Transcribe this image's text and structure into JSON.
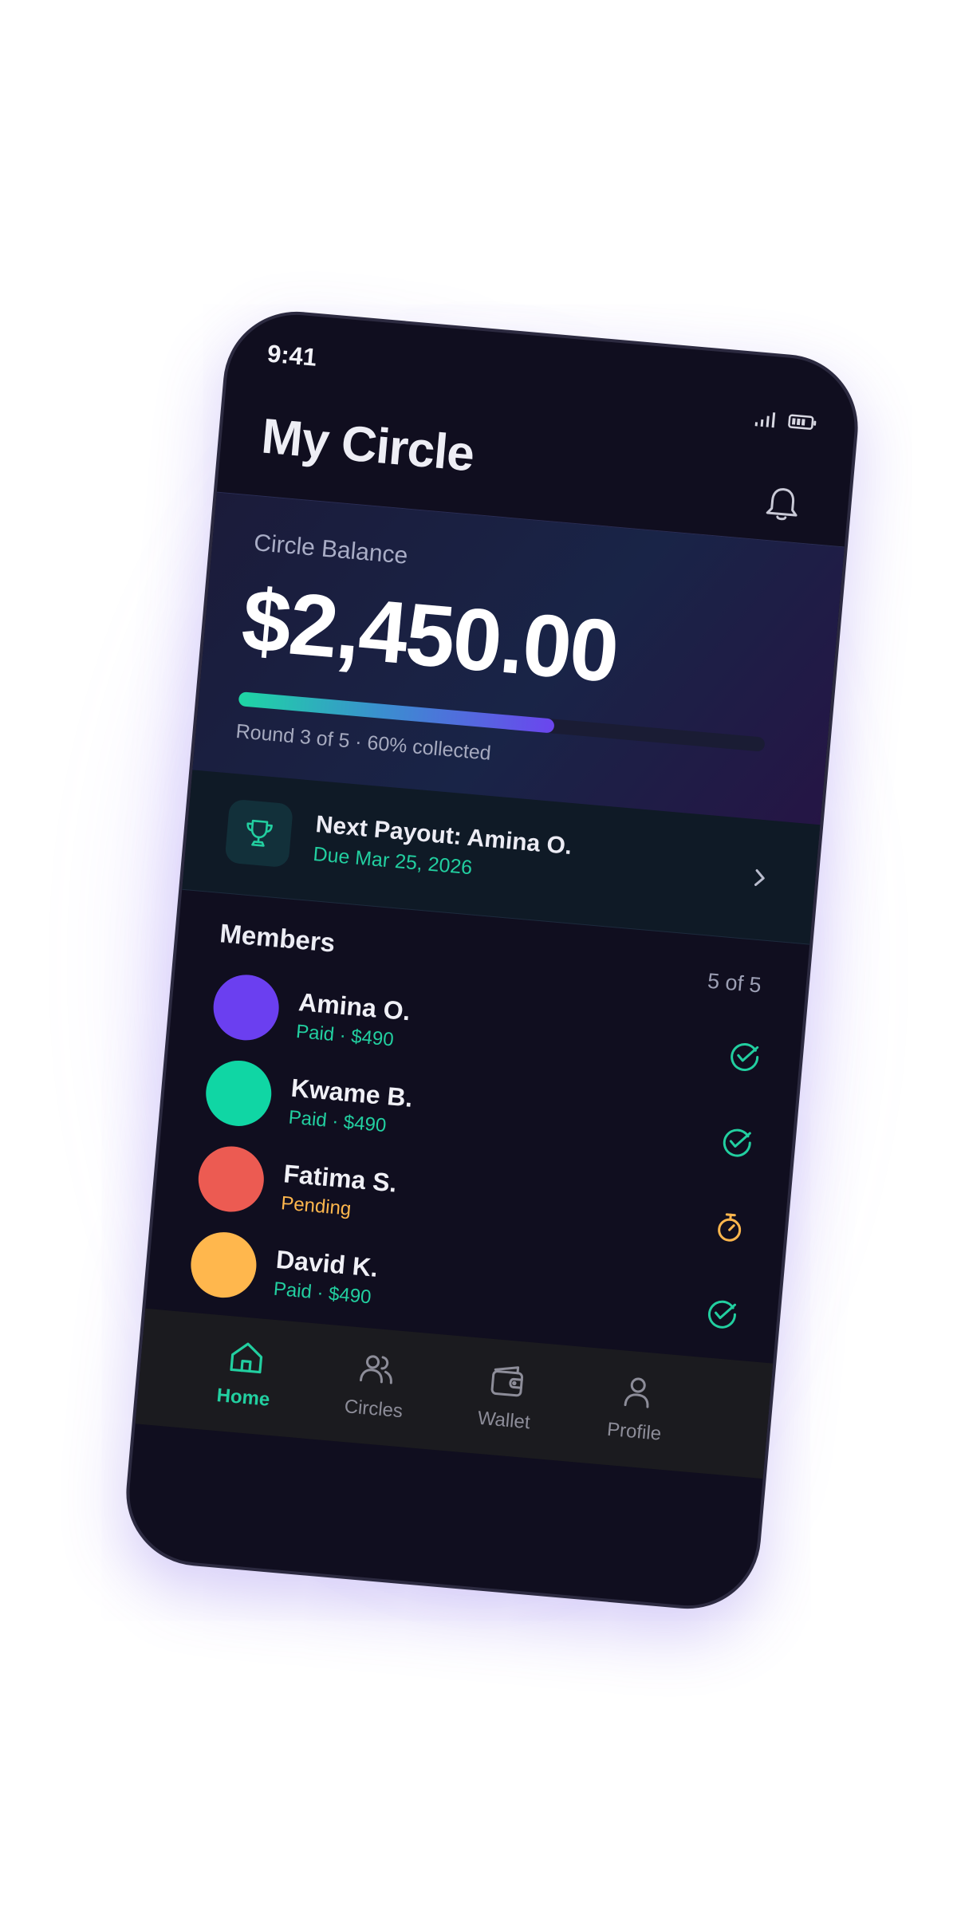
{
  "status_bar": {
    "time": "9:41"
  },
  "header": {
    "title": "My Circle"
  },
  "balance": {
    "label": "Circle Balance",
    "amount": "$2,450.00",
    "progress": 0.6,
    "round_text": "Round 3 of 5 · 60% collected"
  },
  "payout": {
    "title": "Next Payout: Amina O.",
    "due": "Due Mar 25, 2026"
  },
  "members": {
    "title": "Members",
    "count": "5 of 5",
    "items": [
      {
        "name": "Amina O.",
        "status": "Paid · $490",
        "avatar_color": "#6b3ff0",
        "state": "paid"
      },
      {
        "name": "Kwame B.",
        "status": "Paid · $490",
        "avatar_color": "#10d6a4",
        "state": "paid"
      },
      {
        "name": "Fatima S.",
        "status": "Pending",
        "avatar_color": "#ec5b52",
        "state": "pending"
      },
      {
        "name": "David K.",
        "status": "Paid · $490",
        "avatar_color": "#ffb74d",
        "state": "paid"
      }
    ]
  },
  "nav": {
    "items": [
      {
        "label": "Home",
        "icon": "home-icon",
        "active": true
      },
      {
        "label": "Circles",
        "icon": "users-icon",
        "active": false
      },
      {
        "label": "Wallet",
        "icon": "wallet-icon",
        "active": false
      },
      {
        "label": "Profile",
        "icon": "user-icon",
        "active": false
      }
    ]
  },
  "colors": {
    "accent": "#22cfa0",
    "pending": "#ffb74d",
    "background": "#100e1f",
    "progress_start": "#1ed6a4",
    "progress_end": "#6b45ee"
  }
}
